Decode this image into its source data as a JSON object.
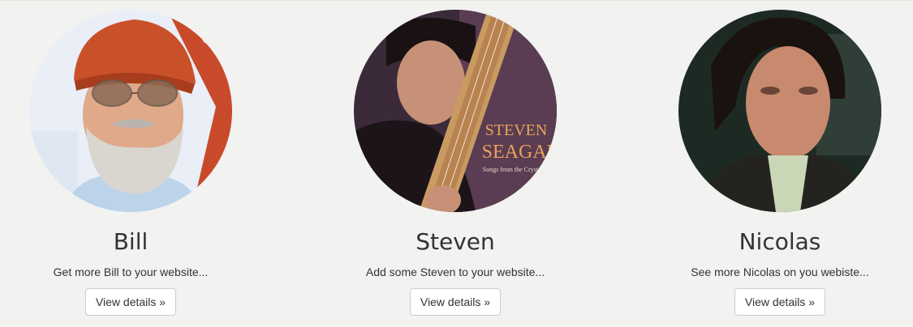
{
  "cards": [
    {
      "name": "Bill",
      "description": "Get more Bill to your website...",
      "button_label": "View details »",
      "image": "bill-portrait"
    },
    {
      "name": "Steven",
      "description": "Add some Steven to your website...",
      "button_label": "View details »",
      "image": "steven-album-cover",
      "image_text": {
        "line1": "STEVEN",
        "line2": "SEAGAL",
        "line3": "Songs from the Crystal Cave"
      }
    },
    {
      "name": "Nicolas",
      "description": "See more Nicolas on you webiste...",
      "button_label": "View details »",
      "image": "nicolas-portrait"
    }
  ],
  "colors": {
    "background": "#f2f2f0",
    "text": "#333333",
    "button_border": "#cccccc"
  }
}
